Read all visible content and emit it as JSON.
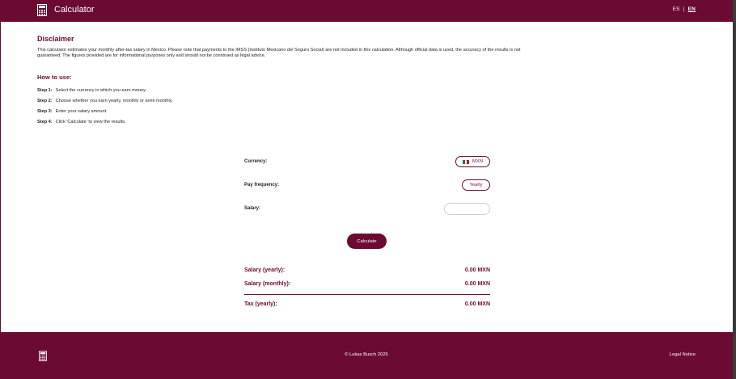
{
  "app": {
    "title": "Calculator"
  },
  "language": {
    "options": [
      "ES",
      "EN"
    ],
    "separator": "|",
    "active": "EN"
  },
  "disclaimer": {
    "heading": "Disclaimer",
    "text": "This calculator estimates your monthly after-tax salary in Mexico. Please note that payments to the IMSS (Instituto Mexicano del Seguro Social) are not included in this calculation. Although official data is used, the accuracy of the results is not guaranteed. The figures provided are for informational purposes only and should not be construed as legal advice."
  },
  "howto": {
    "heading": "How to use:",
    "steps": [
      {
        "label": "Step 1:",
        "text": "Select the currency in which you earn money."
      },
      {
        "label": "Step 2:",
        "text": "Choose whether you earn yearly, monthly or semi monthly."
      },
      {
        "label": "Step 3:",
        "text": "Enter your salary amount."
      },
      {
        "label": "Step 4:",
        "text": "Click 'Calculate' to view the results."
      }
    ]
  },
  "form": {
    "currency_label": "Currency:",
    "currency_value": "MXN",
    "frequency_label": "Pay frequency:",
    "frequency_value": "Yearly",
    "salary_label": "Salary:",
    "salary_value": "",
    "calculate_label": "Calculate"
  },
  "results": {
    "yearly_label": "Salary (yearly):",
    "yearly_value": "0.00 MXN",
    "monthly_label": "Salary (monthly):",
    "monthly_value": "0.00 MXN",
    "tax_label": "Tax (yearly):",
    "tax_value": "0.00 MXN"
  },
  "footer": {
    "copyright": "© Lukas Busch 2025",
    "legal": "Legal Notice"
  },
  "colors": {
    "brand": "#6b0a33",
    "flag_green": "#1f7a3a",
    "flag_white": "#ffffff",
    "flag_red": "#c8102e"
  },
  "icons": {
    "logo": "calculator-icon",
    "footer": "calculator-icon",
    "currency": "mexico-flag-icon"
  }
}
